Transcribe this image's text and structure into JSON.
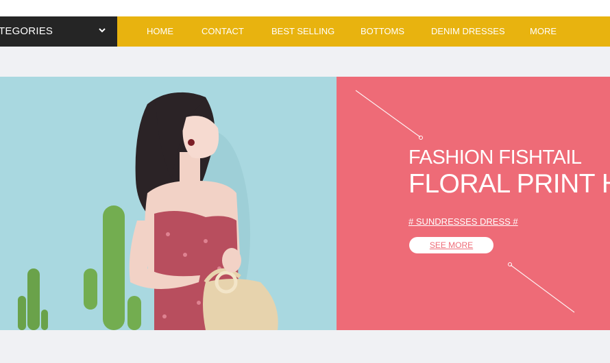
{
  "nav": {
    "categories_label": "TEGORIES",
    "items": [
      {
        "label": "HOME"
      },
      {
        "label": "CONTACT"
      },
      {
        "label": "BEST SELLING"
      },
      {
        "label": "BOTTOMS"
      },
      {
        "label": "DENIM DRESSES"
      },
      {
        "label": "MORE"
      }
    ]
  },
  "banner": {
    "headline_line1": "FASHION FISHTAIL",
    "headline_line2": "FLORAL PRINT HAL",
    "tag_link": "# SUNDRESSES DRESS #",
    "cta_label": "SEE MORE"
  },
  "colors": {
    "nav_background": "#e8b30f",
    "categories_background": "#252525",
    "promo_background": "#ee6b77",
    "photo_background": "#a9d8e0",
    "band_background": "#f0f1f4"
  },
  "icons": {
    "categories_caret": "chevron-down-icon"
  }
}
